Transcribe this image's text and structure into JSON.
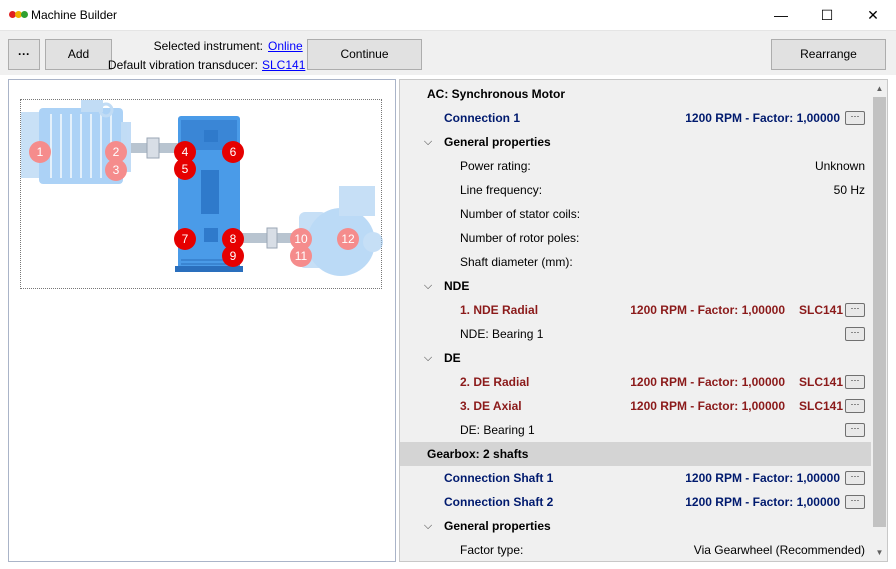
{
  "window": {
    "title": "Machine Builder",
    "icon_colors": [
      "#e02020",
      "#f0b000",
      "#30a030"
    ],
    "minimize_glyph": "—",
    "maximize_glyph": "☐",
    "close_glyph": "✕"
  },
  "toolbar": {
    "more_label": "···",
    "add_label": "Add",
    "selected_instrument_label": "Selected instrument:",
    "selected_instrument_value": "Online",
    "transducer_label": "Default vibration transducer:",
    "transducer_value": "SLC141",
    "continue_label": "Continue",
    "rearrange_label": "Rearrange"
  },
  "diagram": {
    "measurement_points": [
      "1",
      "2",
      "3",
      "4",
      "5",
      "6",
      "7",
      "8",
      "9",
      "10",
      "11",
      "12"
    ],
    "colors": {
      "blue": "#4a9be8",
      "blue_light": "#9cc8f0",
      "point_dim": "#f58c8c",
      "point_solid": "#e60000"
    }
  },
  "properties": {
    "motor": {
      "title": "AC: Synchronous Motor",
      "connection": {
        "label": "Connection 1",
        "value": "1200 RPM - Factor: 1,00000"
      },
      "general": {
        "title": "General properties",
        "rows": [
          {
            "label": "Power rating:",
            "value": "Unknown"
          },
          {
            "label": "Line frequency:",
            "value": "50 Hz"
          },
          {
            "label": "Number of stator coils:",
            "value": ""
          },
          {
            "label": "Number of rotor poles:",
            "value": ""
          },
          {
            "label": "Shaft diameter (mm):",
            "value": ""
          }
        ]
      },
      "nde": {
        "title": "NDE",
        "point": {
          "label": "1. NDE Radial",
          "value": "1200 RPM - Factor: 1,00000",
          "sensor": "SLC141"
        },
        "bearing": "NDE: Bearing 1"
      },
      "de": {
        "title": "DE",
        "points": [
          {
            "label": "2. DE Radial",
            "value": "1200 RPM - Factor: 1,00000",
            "sensor": "SLC141"
          },
          {
            "label": "3. DE Axial",
            "value": "1200 RPM - Factor: 1,00000",
            "sensor": "SLC141"
          }
        ],
        "bearing": "DE: Bearing 1"
      }
    },
    "gearbox": {
      "title": "Gearbox: 2 shafts",
      "connections": [
        {
          "label": "Connection Shaft 1",
          "value": "1200 RPM - Factor: 1,00000"
        },
        {
          "label": "Connection Shaft 2",
          "value": "1200 RPM - Factor: 1,00000"
        }
      ],
      "general": {
        "title": "General properties",
        "rows": [
          {
            "label": "Factor type:",
            "value": "Via Gearwheel (Recommended)"
          }
        ]
      }
    },
    "more_glyph": "···",
    "expand_glyph": "⌵",
    "colors": {
      "navy": "#001a6e",
      "maroon": "#8b1a1a",
      "section_bg": "#d4d4d4"
    }
  },
  "scrollbar": {
    "up_glyph": "▲",
    "down_glyph": "▼"
  }
}
